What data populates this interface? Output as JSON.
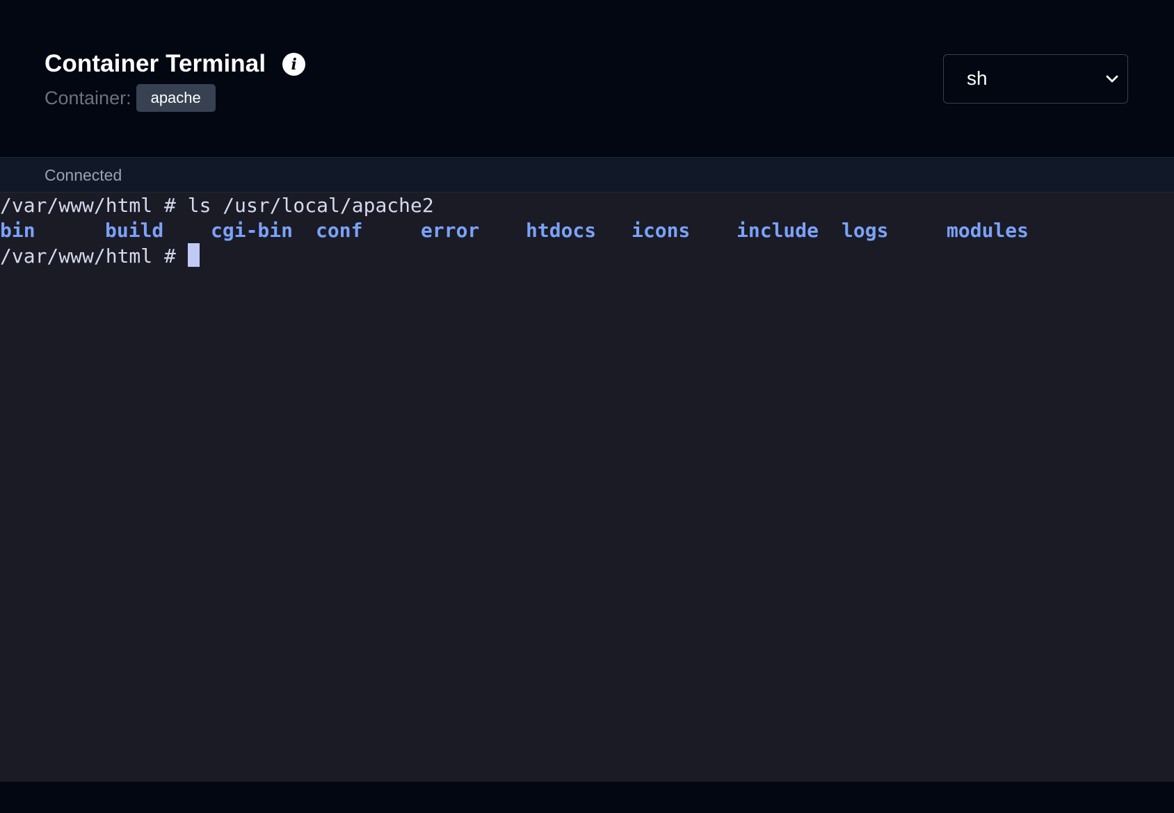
{
  "header": {
    "title": "Container Terminal",
    "info_icon": "info-icon",
    "container_label": "Container:",
    "container_name": "apache",
    "shell_select": {
      "selected": "sh",
      "icon": "chevron-down-icon"
    }
  },
  "status": {
    "text": "Connected"
  },
  "terminal": {
    "line1": "/var/www/html # ls /usr/local/apache2",
    "entries": [
      "bin",
      "build",
      "cgi-bin",
      "conf",
      "error",
      "htdocs",
      "icons",
      "include",
      "logs",
      "modules"
    ],
    "line3_prompt": "/var/www/html # "
  },
  "colors": {
    "header_bg": "#030712",
    "status_bg": "#111827",
    "terminal_bg": "#1b1b26",
    "terminal_fg": "#d4d9ee",
    "directory_color": "#7aa2f7",
    "cursor_color": "#c0caf5",
    "badge_bg": "#374151"
  }
}
